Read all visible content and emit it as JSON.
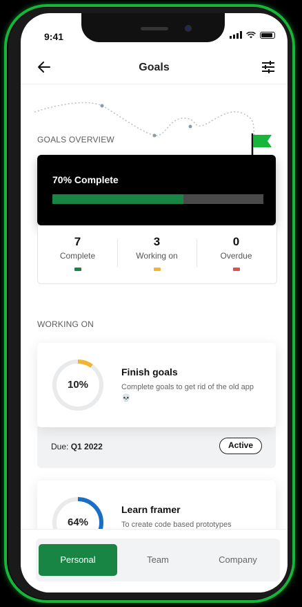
{
  "status_bar": {
    "time": "9:41"
  },
  "header": {
    "title": "Goals"
  },
  "overview": {
    "section_label": "GOALS OVERVIEW",
    "progress_label": "70% Complete",
    "progress_fraction": 0.62,
    "stats": [
      {
        "value": "7",
        "label": "Complete",
        "color": "#188544"
      },
      {
        "value": "3",
        "label": "Working on",
        "color": "#f2b431"
      },
      {
        "value": "0",
        "label": "Overdue",
        "color": "#d9534f"
      }
    ]
  },
  "working_on": {
    "section_label": "WORKING ON",
    "goals": [
      {
        "percent_label": "10%",
        "progress": 0.1,
        "ring_color": "#f2b431",
        "title": "Finish goals",
        "description": "Complete goals to get rid of the old app 💀",
        "due_prefix": "Due:",
        "due_value": "Q1 2022",
        "status": "Active"
      },
      {
        "percent_label": "64%",
        "progress": 0.64,
        "ring_color": "#1a6fc4",
        "title": "Learn framer",
        "description": "To create code based prototypes"
      }
    ]
  },
  "tabs": [
    {
      "label": "Personal",
      "active": true
    },
    {
      "label": "Team",
      "active": false
    },
    {
      "label": "Company",
      "active": false
    }
  ],
  "colors": {
    "accent": "#188544",
    "glow": "#17b53a"
  }
}
